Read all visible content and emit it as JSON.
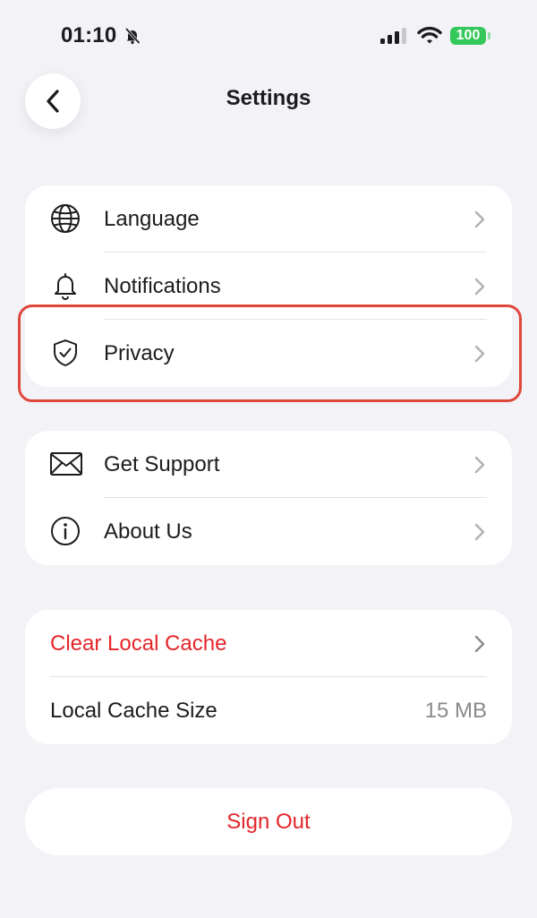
{
  "status_bar": {
    "time": "01:10",
    "battery": "100",
    "battery_color": "#34c759",
    "icons": [
      "bell-slash-icon",
      "signal-icon",
      "wifi-icon",
      "battery-icon"
    ]
  },
  "header": {
    "title": "Settings",
    "back_icon": "chevron-left-icon"
  },
  "groups": [
    {
      "items": [
        {
          "label": "Language",
          "icon": "globe-icon"
        },
        {
          "label": "Notifications",
          "icon": "bell-icon"
        },
        {
          "label": "Privacy",
          "icon": "shield-check-icon",
          "highlighted": true
        }
      ]
    },
    {
      "items": [
        {
          "label": "Get Support",
          "icon": "envelope-icon"
        },
        {
          "label": "About Us",
          "icon": "info-icon"
        }
      ]
    },
    {
      "items": [
        {
          "label": "Clear Local Cache",
          "color": "#e5252a"
        },
        {
          "label": "Local Cache Size",
          "value": "15 MB"
        }
      ]
    }
  ],
  "sign_out": {
    "label": "Sign Out",
    "color": "#e5252a"
  },
  "highlight_color": "#e0473c"
}
